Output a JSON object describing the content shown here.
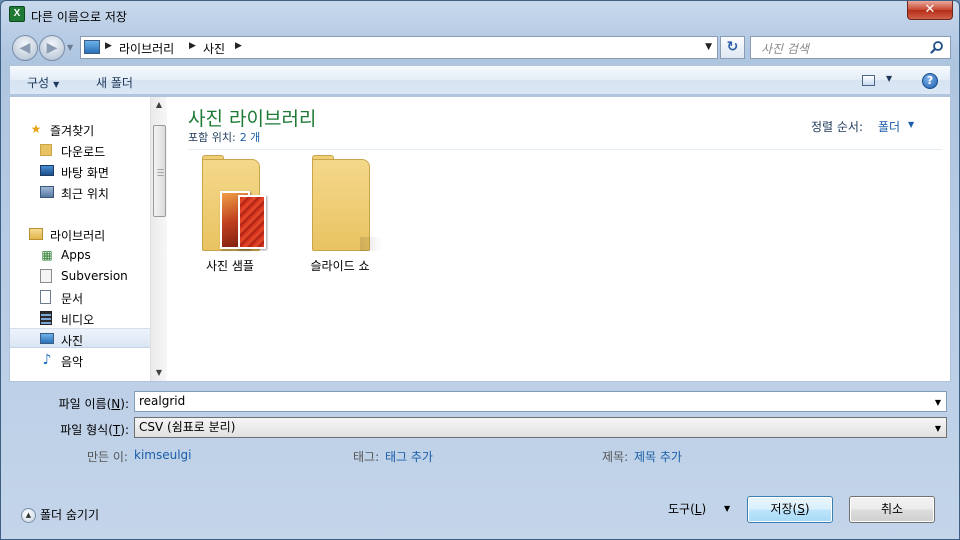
{
  "window": {
    "title": "다른 이름으로 저장",
    "app_icon": "X",
    "close_symbol": "✕"
  },
  "nav": {
    "back_symbol": "◀",
    "forward_symbol": "▶",
    "breadcrumb": [
      "라이브러리",
      "사진"
    ],
    "search_placeholder": "사진 검색",
    "refresh_symbol": "↻"
  },
  "toolbar": {
    "organize_label": "구성",
    "new_folder_label": "새 폴더",
    "help_label": "?"
  },
  "sidebar": {
    "favorites_label": "즐겨찾기",
    "favorites": [
      "다운로드",
      "바탕 화면",
      "최근 위치"
    ],
    "libraries_label": "라이브러리",
    "libraries": [
      "Apps",
      "Subversion",
      "문서",
      "비디오",
      "사진",
      "음악"
    ],
    "selected": "사진"
  },
  "content": {
    "title": "사진 라이브러리",
    "includes_label": "포함 위치:",
    "includes_value": "2 개",
    "sort_label": "정렬 순서:",
    "sort_value": "폴더",
    "folders": [
      {
        "name": "사진 샘플",
        "has_photos": true
      },
      {
        "name": "슬라이드 쇼",
        "has_photos": false
      }
    ]
  },
  "form": {
    "filename_label_pre": "파일 이름(",
    "filename_label_key": "N",
    "filename_label_post": "):",
    "filename_value": "realgrid",
    "filetype_label_pre": "파일 형식(",
    "filetype_label_key": "T",
    "filetype_label_post": "):",
    "filetype_value": "CSV (쉼표로 분리)",
    "author_label": "만든 이:",
    "author_value": "kimseulgi",
    "tags_label": "태그:",
    "tags_value": "태그 추가",
    "title_label": "제목:",
    "title_value": "제목 추가"
  },
  "footer": {
    "hide_folders_label": "폴더 숨기기",
    "tools_label_pre": "도구(",
    "tools_label_key": "L",
    "tools_label_post": ")",
    "save_pre": "저장(",
    "save_key": "S",
    "save_post": ")",
    "cancel_label": "취소"
  },
  "colors": {
    "accent_green": "#1e7a34",
    "link_blue": "#1a5ea8",
    "close_red": "#c7452f"
  }
}
